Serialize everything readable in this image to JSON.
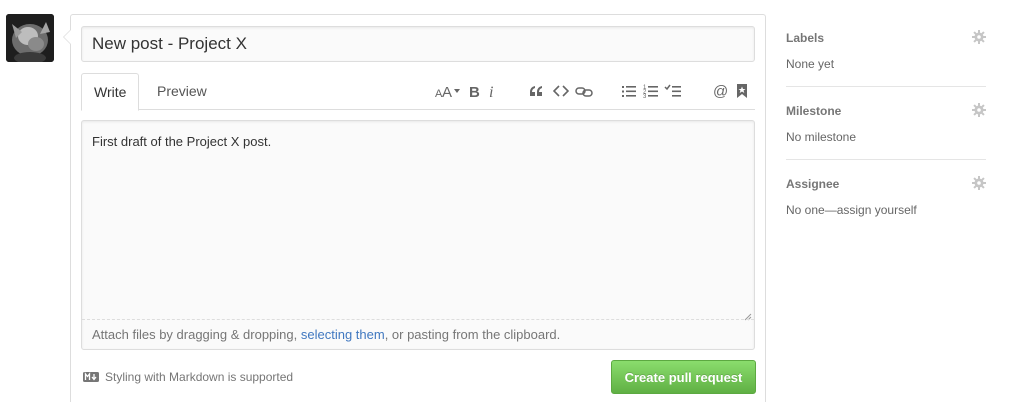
{
  "composer": {
    "title_value": "New post - Project X",
    "tabs": [
      {
        "label": "Write",
        "active": true
      },
      {
        "label": "Preview",
        "active": false
      }
    ],
    "toolbar_icons": [
      "text-size-icon",
      "bold-icon",
      "italic-icon",
      "quote-icon",
      "code-icon",
      "link-icon",
      "bullet-list-icon",
      "numbered-list-icon",
      "task-list-icon",
      "mention-icon",
      "saved-reply-icon"
    ],
    "body_text": "First draft of the Project X post.",
    "attach": {
      "before": "Attach files by dragging & dropping, ",
      "link": "selecting them",
      "after": ", or pasting from the clipboard."
    },
    "markdown_hint": "Styling with Markdown is supported",
    "submit_label": "Create pull request"
  },
  "sidebar": {
    "labels": {
      "heading": "Labels",
      "value": "None yet"
    },
    "milestone": {
      "heading": "Milestone",
      "value": "No milestone"
    },
    "assignee": {
      "heading": "Assignee",
      "value_prefix": "No one—",
      "value_link": "assign yourself"
    }
  },
  "colors": {
    "accent_link": "#4078c0",
    "button_green_top": "#8add6d",
    "button_green_bottom": "#60b044",
    "border": "#dddddd"
  }
}
